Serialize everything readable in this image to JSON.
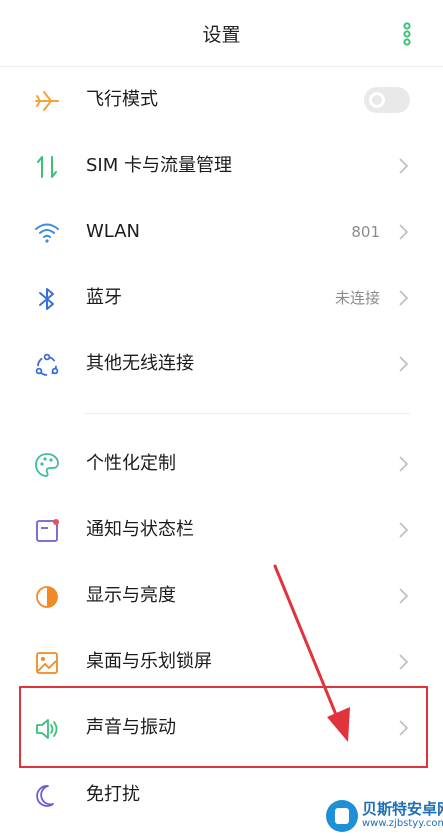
{
  "header": {
    "title": "设置",
    "more_icon": "more-dots-icon"
  },
  "accent_color": "#3dbf7a",
  "highlight_color": "#e0333b",
  "settings": {
    "airplane": {
      "label": "飞行模式",
      "icon": "airplane-icon",
      "toggle_on": false
    },
    "sim": {
      "label": "SIM 卡与流量管理",
      "icon": "sim-data-icon"
    },
    "wlan": {
      "label": "WLAN",
      "value": "801",
      "icon": "wifi-icon"
    },
    "bluetooth": {
      "label": "蓝牙",
      "value": "未连接",
      "icon": "bluetooth-icon"
    },
    "other_wireless": {
      "label": "其他无线连接",
      "icon": "wireless-connections-icon"
    },
    "personalize": {
      "label": "个性化定制",
      "icon": "palette-icon"
    },
    "notifications": {
      "label": "通知与状态栏",
      "icon": "notification-icon"
    },
    "display": {
      "label": "显示与亮度",
      "icon": "brightness-icon"
    },
    "desktop": {
      "label": "桌面与乐划锁屏",
      "icon": "wallpaper-icon"
    },
    "sound": {
      "label": "声音与振动",
      "icon": "speaker-icon"
    },
    "dnd": {
      "label": "免打扰",
      "icon": "moon-icon"
    }
  },
  "watermark": {
    "title": "贝斯特安卓网",
    "url": "www.zjbstyy.com"
  }
}
